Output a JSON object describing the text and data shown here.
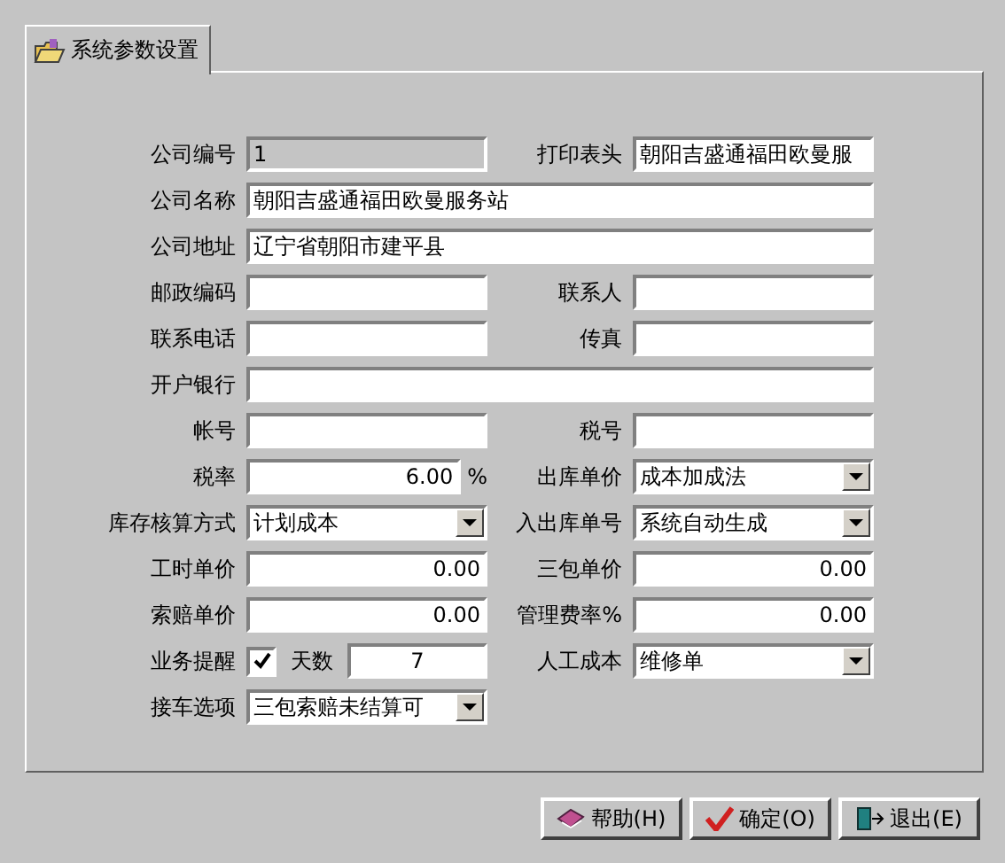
{
  "tab": {
    "label": "系统参数设置",
    "selected": true
  },
  "rows": [
    [
      {
        "label": "公司编号",
        "kind": "text",
        "value": "1",
        "disabled": true
      },
      {
        "label": "打印表头",
        "kind": "text",
        "value": "朝阳吉盛通福田欧曼服",
        "disabled": false
      }
    ],
    [
      {
        "label": "公司名称",
        "kind": "wide",
        "value": "朝阳吉盛通福田欧曼服务站",
        "disabled": false
      }
    ],
    [
      {
        "label": "公司地址",
        "kind": "wide",
        "value": "辽宁省朝阳市建平县",
        "disabled": false
      }
    ],
    [
      {
        "label": "邮政编码",
        "kind": "text",
        "disabled": false
      },
      {
        "label": "联系人",
        "kind": "text",
        "disabled": false
      }
    ],
    [
      {
        "label": "联系电话",
        "kind": "text",
        "disabled": false
      },
      {
        "label": "传真",
        "kind": "text",
        "disabled": false
      }
    ],
    [
      {
        "label": "开户银行",
        "kind": "wide",
        "disabled": false
      }
    ],
    [
      {
        "label": "帐号",
        "kind": "text",
        "disabled": false
      },
      {
        "label": "税号",
        "kind": "text",
        "disabled": false
      }
    ],
    [
      {
        "label": "税率",
        "kind": "percent",
        "value": "6.00",
        "unit": "%",
        "disabled": false
      },
      {
        "label": "出库单价",
        "kind": "select",
        "value": "成本加成法",
        "disabled": false
      }
    ],
    [
      {
        "label": "库存核算方式",
        "kind": "select",
        "value": "计划成本",
        "disabled": false
      },
      {
        "label": "入出库单号",
        "kind": "select",
        "value": "系统自动生成",
        "disabled": false
      }
    ],
    [
      {
        "label": "工时单价",
        "kind": "number",
        "value": "0.00",
        "disabled": false
      },
      {
        "label": "三包单价",
        "kind": "number",
        "value": "0.00",
        "disabled": false
      }
    ],
    [
      {
        "label": "索赔单价",
        "kind": "number",
        "value": "0.00",
        "disabled": false
      },
      {
        "label": "管理费率%",
        "kind": "number",
        "value": "0.00",
        "disabled": false
      }
    ],
    [
      {
        "label": "业务提醒",
        "kind": "reminder",
        "checked": true,
        "days_label": "天数",
        "value": "7",
        "disabled": false
      },
      {
        "label": "人工成本",
        "kind": "select",
        "value": "维修单",
        "disabled": false
      }
    ],
    [
      {
        "label": "接车选项",
        "kind": "select",
        "value": "三包索赔未结算可",
        "disabled": false
      }
    ]
  ],
  "buttons": [
    {
      "label": "帮助(H)",
      "kind": "help"
    },
    {
      "label": "确定(O)",
      "kind": "ok"
    },
    {
      "label": "退出(E)",
      "kind": "exit"
    }
  ]
}
